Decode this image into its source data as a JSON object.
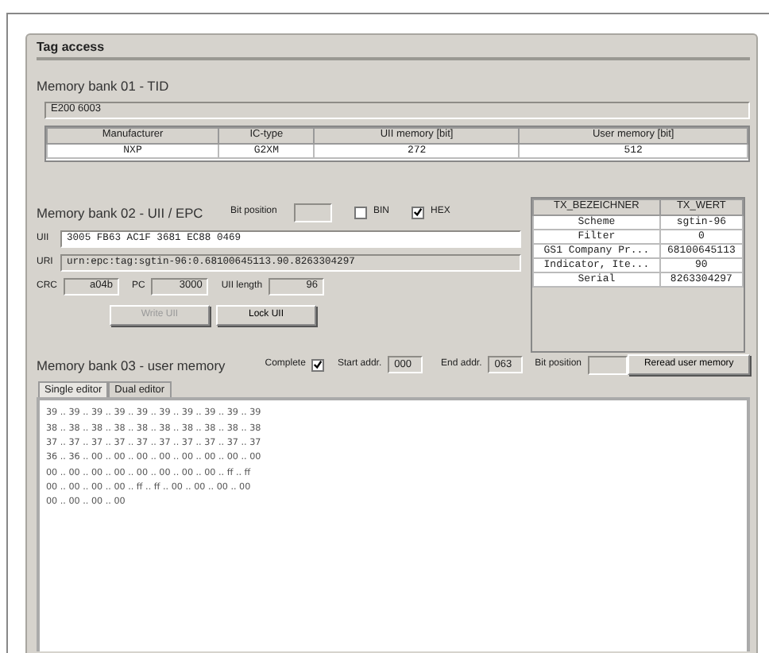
{
  "panel": {
    "title": "Tag access"
  },
  "tid": {
    "heading": "Memory bank 01 - TID",
    "value": "E200 6003",
    "table": {
      "columns": [
        "Manufacturer",
        "IC-type",
        "UII memory [bit]",
        "User memory [bit]"
      ],
      "rows": [
        [
          "NXP",
          "G2XM",
          "272",
          "512"
        ]
      ]
    }
  },
  "epc": {
    "heading": "Memory bank 02 - UII / EPC",
    "bit_position_label": "Bit position",
    "options": [
      {
        "label": "BIN",
        "checked": false
      },
      {
        "label": "HEX",
        "checked": true
      }
    ],
    "fields": [
      {
        "label": "UII",
        "value": "3005 FB63 AC1F 3681 EC88 0469",
        "disabled": false
      },
      {
        "label": "URI",
        "value": "urn:epc:tag:sgtin-96:0.68100645113.90.8263304297",
        "disabled": true
      }
    ],
    "small_fields": [
      {
        "label": "CRC",
        "value": "a04b"
      },
      {
        "label": "PC",
        "value": "3000"
      },
      {
        "label": "UII length",
        "value": "96"
      }
    ],
    "buttons": [
      {
        "label": "Write UII",
        "disabled": true
      },
      {
        "label": "Lock UII",
        "disabled": false
      }
    ],
    "decode_table": {
      "columns": [
        "TX_BEZEICHNER",
        "TX_WERT"
      ],
      "rows": [
        [
          "Scheme",
          "sgtin-96"
        ],
        [
          "Filter",
          "0"
        ],
        [
          "GS1 Company Pr...",
          "68100645113"
        ],
        [
          "Indicator, Ite...",
          "90"
        ],
        [
          "Serial",
          "8263304297"
        ]
      ]
    }
  },
  "user_memory": {
    "heading": "Memory bank 03 - user memory",
    "complete": {
      "label": "Complete",
      "checked": true
    },
    "start": {
      "label": "Start addr.",
      "value": "000"
    },
    "end": {
      "label": "End addr.",
      "value": "063"
    },
    "bit_position_label": "Bit position",
    "reread_button": "Reread user memory",
    "tabs": [
      {
        "label": "Single editor",
        "selected": true
      },
      {
        "label": "Dual editor",
        "selected": false
      }
    ],
    "lines": [
      "39 .. 39 .. 39 .. 39 .. 39 .. 39 .. 39 .. 39 .. 39 .. 39",
      "38 .. 38 .. 38 .. 38 .. 38 .. 38 .. 38 .. 38 .. 38 .. 38",
      "37 .. 37 .. 37 .. 37 .. 37 .. 37 .. 37 .. 37 .. 37 .. 37",
      "36 .. 36 .. 00 .. 00 .. 00 .. 00 .. 00 .. 00 .. 00 .. 00",
      "00 .. 00 .. 00 .. 00 .. 00 .. 00 .. 00 .. 00 .. ff .. ff",
      "00 .. 00 .. 00 .. 00 .. ff .. ff .. 00 .. 00 .. 00 .. 00",
      "00 .. 00 .. 00 .. 00"
    ]
  }
}
